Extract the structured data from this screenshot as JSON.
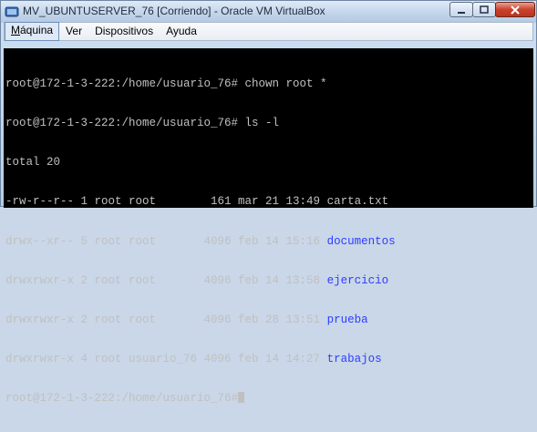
{
  "window": {
    "title": "MV_UBUNTUSERVER_76 [Corriendo] - Oracle VM VirtualBox",
    "app_icon": "virtualbox-icon",
    "minimize_icon": "minimize-icon",
    "maximize_icon": "maximize-icon",
    "close_icon": "close-icon"
  },
  "menu": {
    "items": [
      {
        "label": "Máquina"
      },
      {
        "label": "Ver"
      },
      {
        "label": "Dispositivos"
      },
      {
        "label": "Ayuda"
      }
    ]
  },
  "terminal": {
    "lines": [
      {
        "prefix": "root@172-1-3-222:/home/usuario_76# chown root *",
        "name": ""
      },
      {
        "prefix": "root@172-1-3-222:/home/usuario_76# ls -l",
        "name": ""
      },
      {
        "prefix": "total 20",
        "name": ""
      },
      {
        "prefix": "-rw-r--r-- 1 root root        161 mar 21 13:49 ",
        "name": "carta.txt",
        "color": "#c0c0c0"
      },
      {
        "prefix": "drwx--xr-- 5 root root       4096 feb 14 15:16 ",
        "name": "documentos",
        "color": "#2e3cff"
      },
      {
        "prefix": "drwxrwxr-x 2 root root       4096 feb 14 13:58 ",
        "name": "ejercicio",
        "color": "#2e3cff"
      },
      {
        "prefix": "drwxrwxr-x 2 root root       4096 feb 28 13:51 ",
        "name": "prueba",
        "color": "#2e3cff"
      },
      {
        "prefix": "drwxrwxr-x 4 root usuario_76 4096 feb 14 14:27 ",
        "name": "trabajos",
        "color": "#2e3cff"
      },
      {
        "prefix": "root@172-1-3-222:/home/usuario_76#",
        "name": ""
      }
    ]
  }
}
